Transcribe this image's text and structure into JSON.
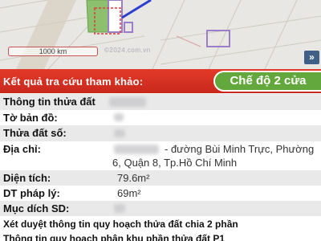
{
  "map": {
    "scale_label": "1000 km",
    "watermark": "©2024.com.vn",
    "expand_label": "»"
  },
  "header": {
    "title": "Kết quả tra cứu tham khảo:",
    "mode_button": "Chế độ 2 cửa"
  },
  "info": {
    "parcel_info_label": "Thông tin thửa đất",
    "map_sheet_label": "Tờ bản đồ:",
    "parcel_no_label": "Thửa đất số:",
    "address_label": "Địa chỉ:",
    "address_line1": "- đường Bùi Minh Trực, Phường",
    "address_line2": "6, Quận 8, Tp.Hồ Chí Minh",
    "area_label": "Diện tích:",
    "area_value": "79.6m²",
    "legal_area_label": "DT pháp lý:",
    "legal_area_value": "69m²",
    "usage_label": "Mục dích SD:",
    "plan_review_text": "Xét duyệt thông tin quy hoạch thửa đất chia 2 phần",
    "plan_zone_text": "Thông tin quy hoạch phân khu phần thửa đất P1"
  },
  "colors": {
    "header_red": "#d8321f",
    "button_green": "#63a83d",
    "row_shade": "#e9e9e9",
    "parcel_outline": "#9a7fc8",
    "highlight_blue": "#2b3fd0"
  }
}
